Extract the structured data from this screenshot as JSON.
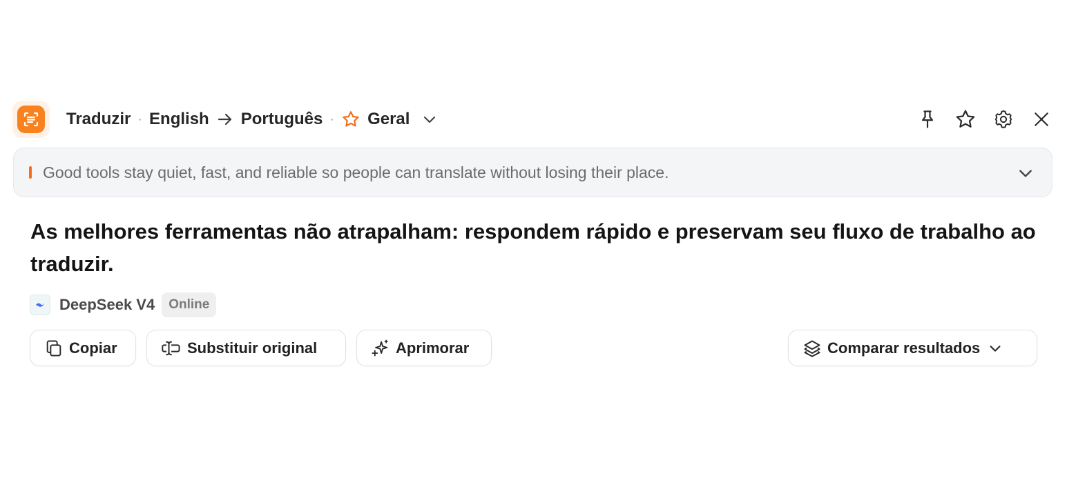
{
  "header": {
    "mode": "Traduzir",
    "separator": "·",
    "source_lang": "English",
    "target_lang": "Português",
    "style": "Geral",
    "icons": {
      "logo": "translate-logo-icon",
      "arrow": "arrow-right-icon",
      "style_star": "star-outline-icon",
      "chevron": "chevron-down-icon",
      "pin": "pin-icon",
      "favorite": "star-icon",
      "settings": "gear-icon",
      "close": "close-icon"
    }
  },
  "source": {
    "text": "Good tools stay quiet, fast, and reliable so people can translate without losing their place."
  },
  "translation": {
    "text": "As melhores ferramentas não atrapalham: respondem rápido e preservam seu fluxo de trabalho ao traduzir."
  },
  "engine": {
    "name": "DeepSeek V4",
    "status": "Online"
  },
  "actions": {
    "copy_label": "Copiar",
    "replace_label": "Substituir original",
    "improve_label": "Aprimorar",
    "compare_label": "Comparar resultados"
  },
  "colors": {
    "accent": "#f7821f",
    "source_bar": "#f36f1c",
    "source_bg": "#f4f5f7",
    "badge_bg": "#efefef"
  }
}
